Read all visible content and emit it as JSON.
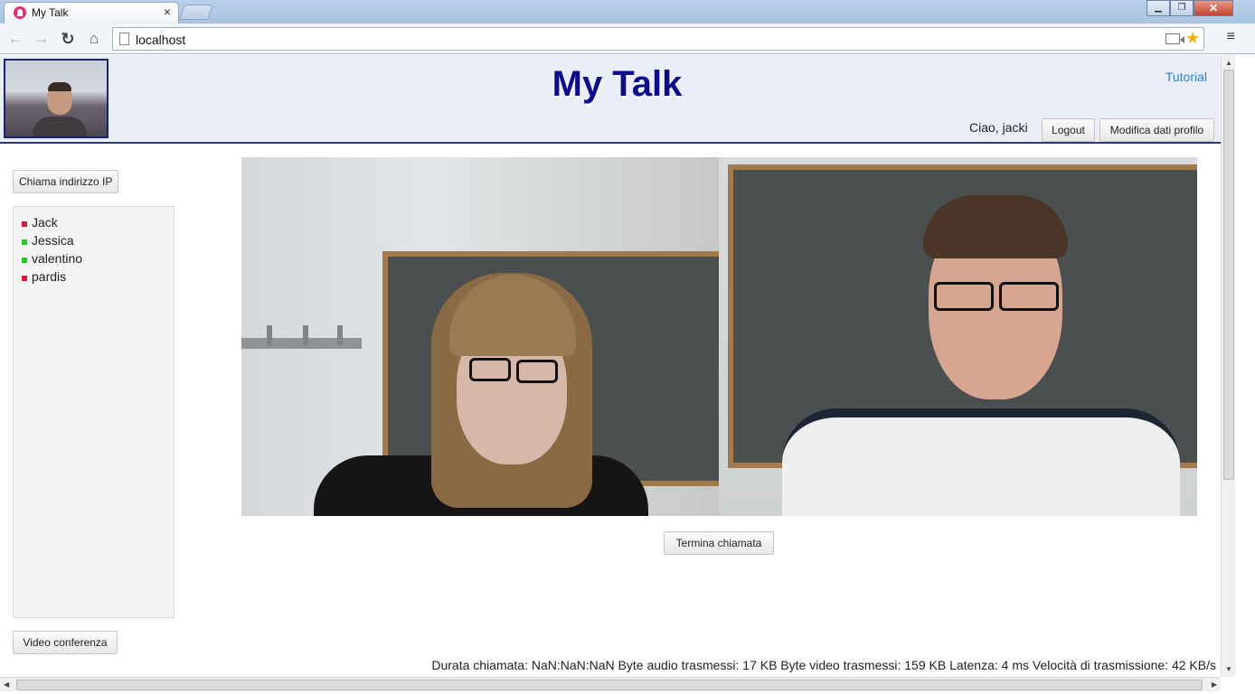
{
  "browser": {
    "tab_title": "My Talk",
    "tab_close": "×",
    "url": "localhost",
    "window_controls": {
      "minimize": "▁",
      "maximize": "❐",
      "close": "✕"
    },
    "icons": [
      "back-icon",
      "forward-icon",
      "reload-icon",
      "home-icon",
      "page-icon",
      "camera-icon",
      "star-icon",
      "menu-icon"
    ],
    "icon_glyphs": {
      "back": "←",
      "forward": "→",
      "reload": "↻",
      "home": "⌂",
      "star": "★",
      "menu": "≡"
    }
  },
  "header": {
    "title": "My Talk",
    "tutorial_link": "Tutorial",
    "greeting": "Ciao, jacki",
    "logout_label": "Logout",
    "edit_profile_label": "Modifica dati profilo"
  },
  "sidebar": {
    "call_ip_label": "Chiama indirizzo IP",
    "contacts": [
      {
        "name": "Jack",
        "status": "offline",
        "status_color": "#d8193a"
      },
      {
        "name": "Jessica",
        "status": "online",
        "status_color": "#22cc22"
      },
      {
        "name": "valentino",
        "status": "online",
        "status_color": "#22cc22"
      },
      {
        "name": "pardis",
        "status": "offline",
        "status_color": "#d8193a"
      }
    ],
    "video_conference_label": "Video conferenza"
  },
  "call": {
    "end_call_label": "Termina chiamata",
    "stats": "Durata chiamata: NaN:NaN:NaN Byte audio trasmessi: 17 KB Byte video trasmessi: 159 KB Latenza: 4 ms Velocità di trasmissione: 42 KB/s"
  },
  "colors": {
    "title": "#0d0d8c",
    "header_background": "#e9eef9",
    "link": "#2d7fc1"
  }
}
